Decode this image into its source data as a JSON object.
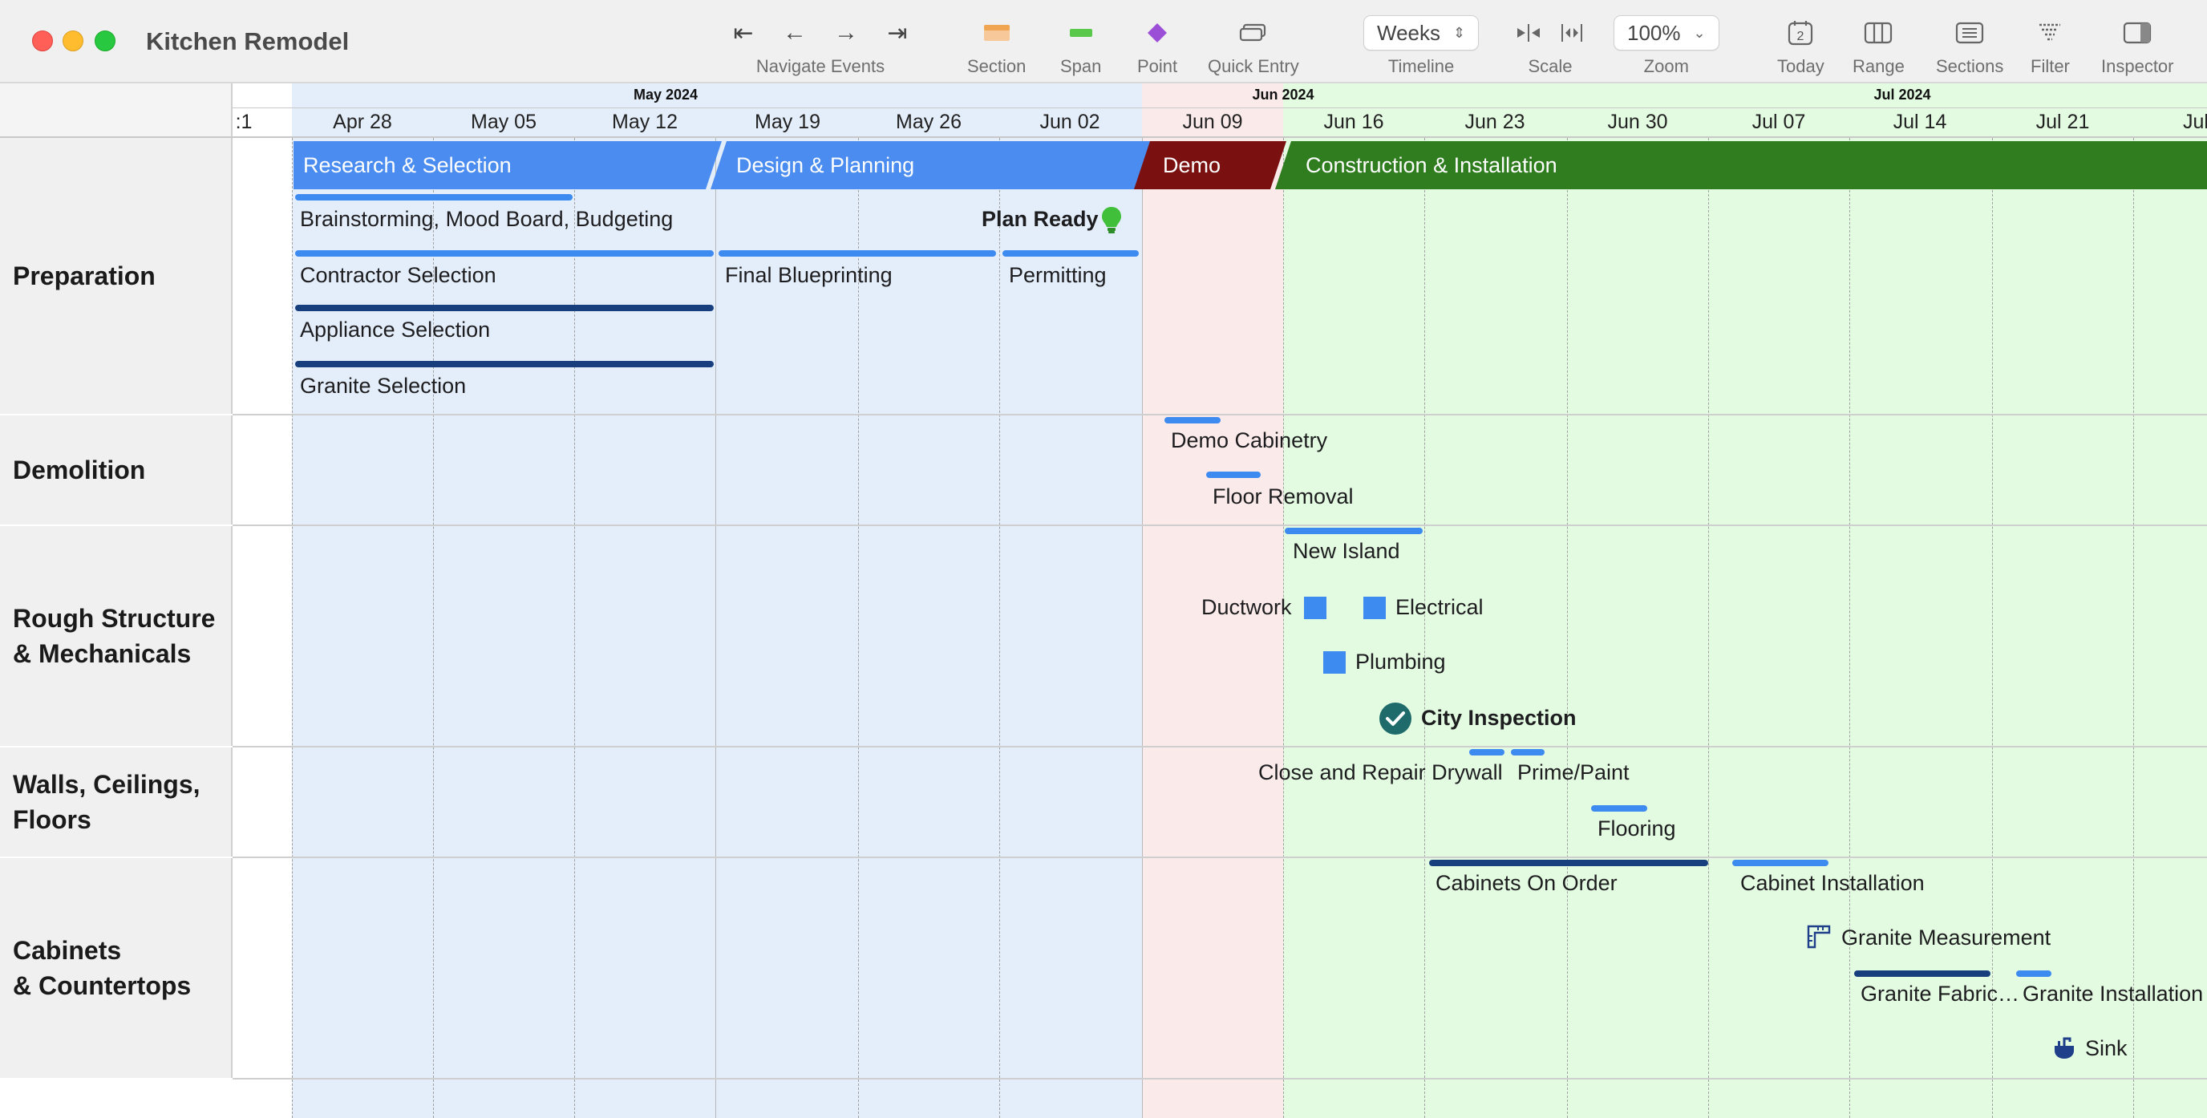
{
  "window": {
    "title": "Kitchen Remodel"
  },
  "toolbar": {
    "navigate_label": "Navigate Events",
    "section_label": "Section",
    "span_label": "Span",
    "point_label": "Point",
    "quick_entry_label": "Quick Entry",
    "timeline_value": "Weeks",
    "timeline_label": "Timeline",
    "scale_label": "Scale",
    "zoom_value": "100%",
    "zoom_label": "Zoom",
    "today_label": "Today",
    "today_badge": "2",
    "range_label": "Range",
    "sections_label": "Sections",
    "filter_label": "Filter",
    "inspector_label": "Inspector"
  },
  "colors": {
    "section_icon": "#f0a552",
    "span_icon": "#5ac84a",
    "point_icon": "#9b4fd6",
    "blue_band": "#e4eefb",
    "pink_band": "#fbeaea",
    "green_band": "#e3fbe1",
    "research_banner": "#4a8cef",
    "demo_banner": "#7a1010",
    "construction_banner": "#2f7d1f",
    "light_bar": "#3d8bf0",
    "dark_bar": "#173f7e"
  },
  "header": {
    "months": [
      "May 2024",
      "Jun 2024",
      "Jul 2024"
    ],
    "partial_left": ":1",
    "weeks": [
      "Apr 28",
      "May 05",
      "May 12",
      "May 19",
      "May 26",
      "Jun 02",
      "Jun 09",
      "Jun 16",
      "Jun 23",
      "Jun 30",
      "Jul 07",
      "Jul 14",
      "Jul 21",
      "Jul"
    ]
  },
  "sections": [
    {
      "label": "Preparation"
    },
    {
      "label": "Demolition"
    },
    {
      "label": "Rough Structure\n& Mechanicals"
    },
    {
      "label": "Walls, Ceilings,\nFloors"
    },
    {
      "label": "Cabinets\n& Countertops"
    }
  ],
  "phases": [
    "Research & Selection",
    "Design & Planning",
    "Demo",
    "Construction & Installation"
  ],
  "events": {
    "brainstorming": "Brainstorming, Mood Board, Budgeting",
    "plan_ready": "Plan Ready",
    "contractor": "Contractor Selection",
    "blueprinting": "Final Blueprinting",
    "permitting": "Permitting",
    "appliance": "Appliance Selection",
    "granite_selection": "Granite Selection",
    "demo_cabinetry": "Demo Cabinetry",
    "floor_removal": "Floor Removal",
    "new_island": "New Island",
    "ductwork": "Ductwork",
    "electrical": "Electrical",
    "plumbing": "Plumbing",
    "city_inspection": "City Inspection",
    "drywall": "Close and Repair Drywall",
    "prime_paint": "Prime/Paint",
    "flooring": "Flooring",
    "cabinets_order": "Cabinets On Order",
    "cabinet_install": "Cabinet Installation",
    "granite_measure": "Granite Measurement",
    "granite_fab": "Granite Fabric…",
    "granite_install": "Granite Installation",
    "sink": "Sink"
  }
}
